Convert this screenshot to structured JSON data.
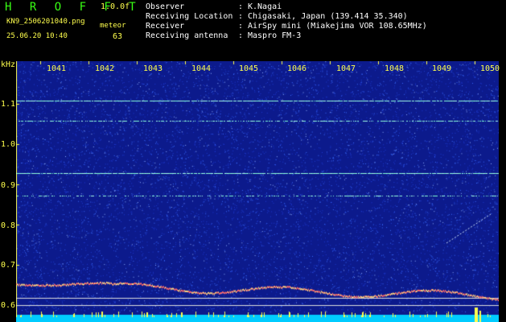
{
  "header": {
    "app_title": "H R O F F T",
    "version": "1.0.0f",
    "filename": "KN9_2506201040.png",
    "meteor_label": "meteor",
    "meteor_count": "63",
    "timestamp": "25.06.20 10:40"
  },
  "info": [
    {
      "label": "Observer",
      "value": "K.Nagai"
    },
    {
      "label": "Receiving Location",
      "value": "Chigasaki, Japan (139.414 35.340)"
    },
    {
      "label": "Receiver",
      "value": "AirSpy mini (Miakejima VOR 108.65MHz)"
    },
    {
      "label": "Receiving antenna",
      "value": "Maspro FM-3"
    }
  ],
  "spectrogram": {
    "y_unit": "kHz",
    "y_ticks": [
      "1.1",
      "1.0",
      "0.9",
      "0.8",
      "0.7",
      "0.6"
    ],
    "x_ticks": [
      "1041",
      "1042",
      "1043",
      "1044",
      "1045",
      "1046",
      "1047",
      "1048",
      "1049",
      "1050"
    ],
    "colors": {
      "background": "#0c1a8c",
      "noise": "#3a6cff",
      "carrier": "#7fffd4",
      "trace": "#ff6b6b",
      "axis": "#ffff4d",
      "bottom_bar": "#00ccff"
    }
  }
}
